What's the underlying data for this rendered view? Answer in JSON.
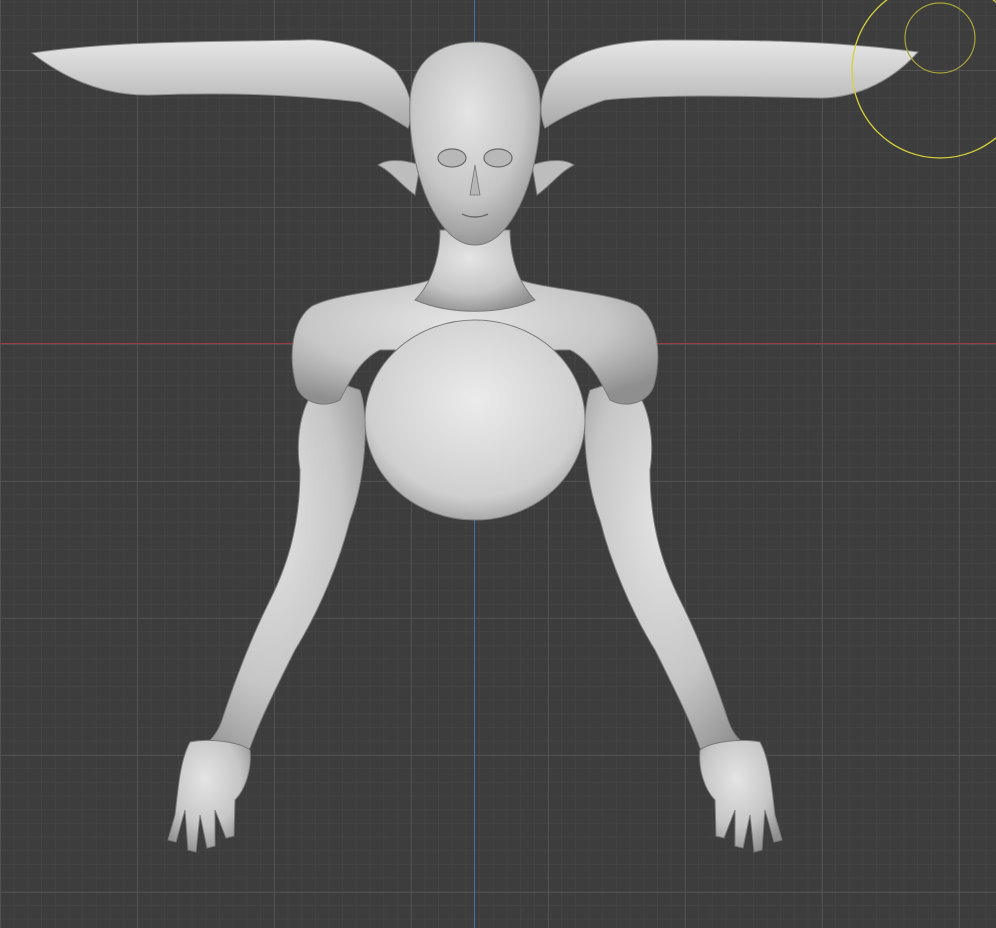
{
  "viewport": {
    "background_color": "#3d3d3d",
    "grid_color": "#525252",
    "x_axis_color": "#9b3a44",
    "y_axis_color": "#3d6fb3"
  },
  "model": {
    "object": "sculpted-creature-bust",
    "shading_color": "#c9c9c9"
  },
  "brush_cursor": {
    "color": "#d6d23a",
    "icon": "sculpt-brush-cursor-icon"
  }
}
